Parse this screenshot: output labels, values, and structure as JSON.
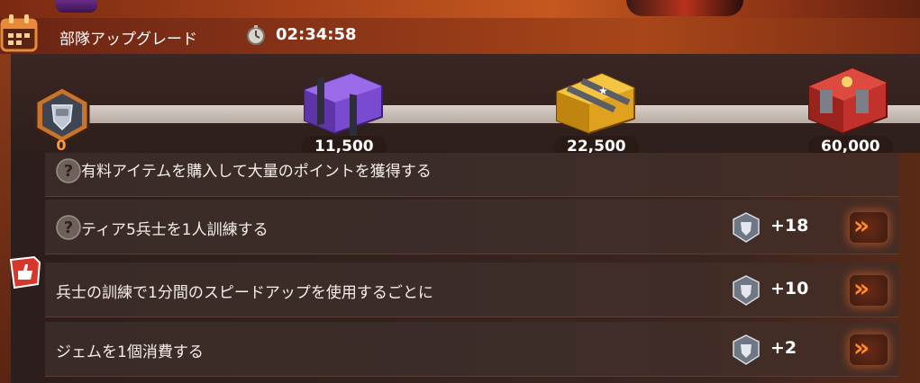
{
  "header": {
    "title": "部隊アップグレード",
    "timer": "02:34:58"
  },
  "progress": {
    "current_points": "0",
    "milestones": [
      {
        "label": "11,500",
        "crate": "purple-crate"
      },
      {
        "label": "22,500",
        "crate": "gold-crate"
      },
      {
        "label": "60,000",
        "crate": "red-crate"
      }
    ]
  },
  "tasks": [
    {
      "text": "有料アイテムを購入して大量のポイントを獲得する",
      "points": "",
      "icon": "question-icon"
    },
    {
      "text": "ティア5兵士を1人訓練する",
      "points": "+18",
      "icon": "question-icon"
    },
    {
      "text": "兵士の訓練で1分間のスピードアップを使用するごとに",
      "points": "+10",
      "icon": "thumbs-up-icon"
    },
    {
      "text": "ジェムを1個消費する",
      "points": "+2",
      "icon": ""
    }
  ],
  "go_button": "»",
  "colors": {
    "accent_orange": "#ff8a2a",
    "header_red": "#8d3618",
    "row_bg": "#3d2d29"
  }
}
